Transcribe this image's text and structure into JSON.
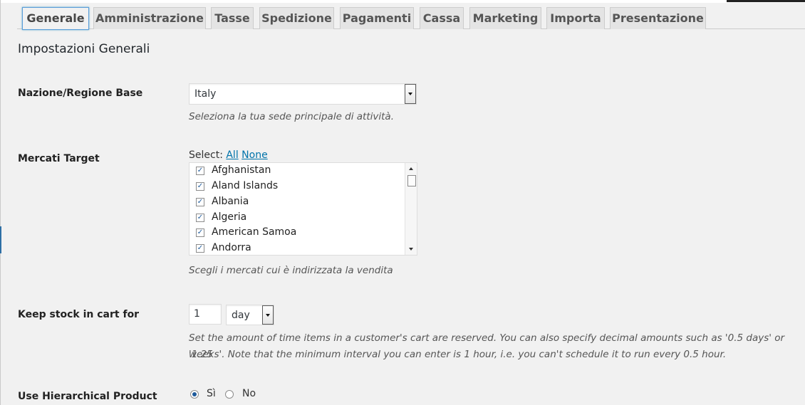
{
  "tabs": [
    {
      "label": "Generale",
      "active": true
    },
    {
      "label": "Amministrazione",
      "active": false
    },
    {
      "label": "Tasse",
      "active": false
    },
    {
      "label": "Spedizione",
      "active": false
    },
    {
      "label": "Pagamenti",
      "active": false
    },
    {
      "label": "Cassa",
      "active": false
    },
    {
      "label": "Marketing",
      "active": false
    },
    {
      "label": "Importa",
      "active": false
    },
    {
      "label": "Presentazione",
      "active": false
    }
  ],
  "section_title": "Impostazioni Generali",
  "base_country": {
    "label": "Nazione/Regione Base",
    "value": "Italy",
    "description": "Seleziona la tua sede principale di attività."
  },
  "target_markets": {
    "label": "Mercati Target",
    "select_prefix": "Select:",
    "select_all": "All",
    "select_none": "None",
    "countries": [
      {
        "name": "Afghanistan",
        "checked": true
      },
      {
        "name": "Aland Islands",
        "checked": true
      },
      {
        "name": "Albania",
        "checked": true
      },
      {
        "name": "Algeria",
        "checked": true
      },
      {
        "name": "American Samoa",
        "checked": true
      },
      {
        "name": "Andorra",
        "checked": true
      }
    ],
    "description": "Scegli i mercati cui è indirizzata la vendita"
  },
  "stock_in_cart": {
    "label": "Keep stock in cart for",
    "amount": "1",
    "unit": "day",
    "description_line1": "Set the amount of time items in a customer's cart are reserved. You can also specify decimal amounts such as '0.5 days' or '1.25",
    "description_line2": "weeks'. Note that the minimum interval you can enter is 1 hour, i.e. you can't schedule it to run every 0.5 hour."
  },
  "hierarchical": {
    "label": "Use Hierarchical Product",
    "options": [
      {
        "label": "Sì",
        "selected": true
      },
      {
        "label": "No",
        "selected": false
      }
    ]
  },
  "colors": {
    "link": "#0073aa",
    "active_tab_border": "#5b9dd9",
    "page_background": "#f1f1f1"
  }
}
